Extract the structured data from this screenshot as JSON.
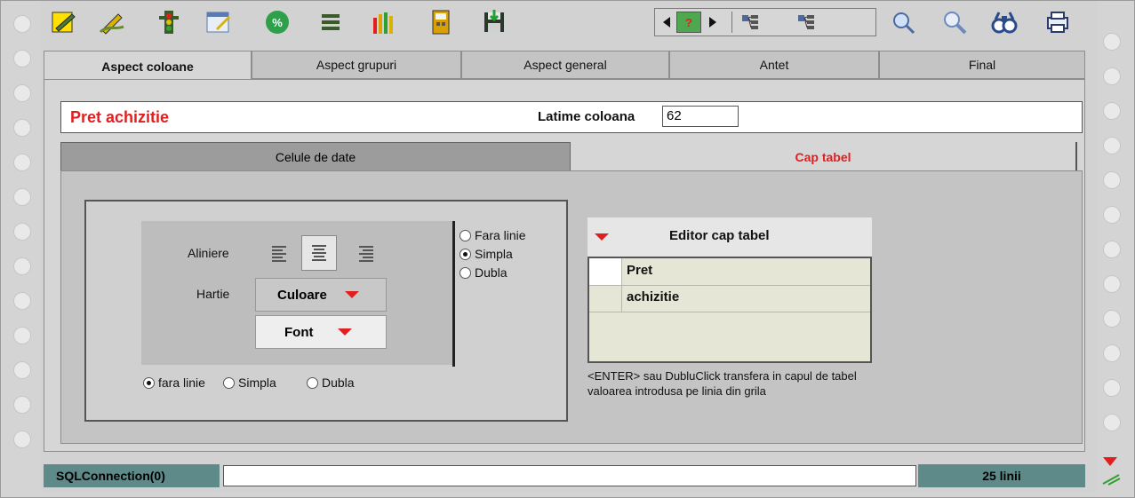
{
  "toolbar": {
    "icons": [
      "edit-report-icon",
      "pencil-icon",
      "traffic-light-icon",
      "notepad-icon",
      "percent-icon",
      "list-icon",
      "pencils-icon",
      "calculator-icon",
      "save-disk-icon"
    ],
    "nav_help": "?",
    "right_icons": [
      "tree-icon",
      "tree-icon-2",
      "zoom-icon",
      "zoom-out-icon",
      "binoculars-icon",
      "printer-icon"
    ]
  },
  "tabs": [
    {
      "label": "Aspect coloane",
      "active": true
    },
    {
      "label": "Aspect grupuri",
      "active": false
    },
    {
      "label": "Aspect general",
      "active": false
    },
    {
      "label": "Antet",
      "active": false
    },
    {
      "label": "Final",
      "active": false
    }
  ],
  "column": {
    "name": "Pret achizitie",
    "width_label": "Latime coloana",
    "width_value": "62"
  },
  "subtabs": [
    {
      "label": "Celule de date",
      "active": false
    },
    {
      "label": "Cap tabel",
      "active": true
    }
  ],
  "format": {
    "align_label": "Aliniere",
    "paper_label": "Hartie",
    "color_button": "Culoare",
    "font_button": "Font",
    "right_border_options": [
      {
        "label": "Fara linie",
        "selected": false
      },
      {
        "label": "Simpla",
        "selected": true
      },
      {
        "label": "Dubla",
        "selected": false
      }
    ],
    "bottom_border_options": [
      {
        "label": "fara linie",
        "selected": true
      },
      {
        "label": "Simpla",
        "selected": false
      },
      {
        "label": "Dubla",
        "selected": false
      }
    ]
  },
  "header_editor": {
    "title": "Editor cap tabel",
    "rows": [
      "Pret",
      "achizitie"
    ],
    "hint": "<ENTER> sau DubluClick transfera in capul de tabel valoarea introdusa pe linia din grila"
  },
  "status": {
    "connection": "SQLConnection(0)",
    "field": "",
    "lines": "25 linii"
  },
  "colors": {
    "accent": "#e02020",
    "status_bg": "#5e8a8a"
  }
}
